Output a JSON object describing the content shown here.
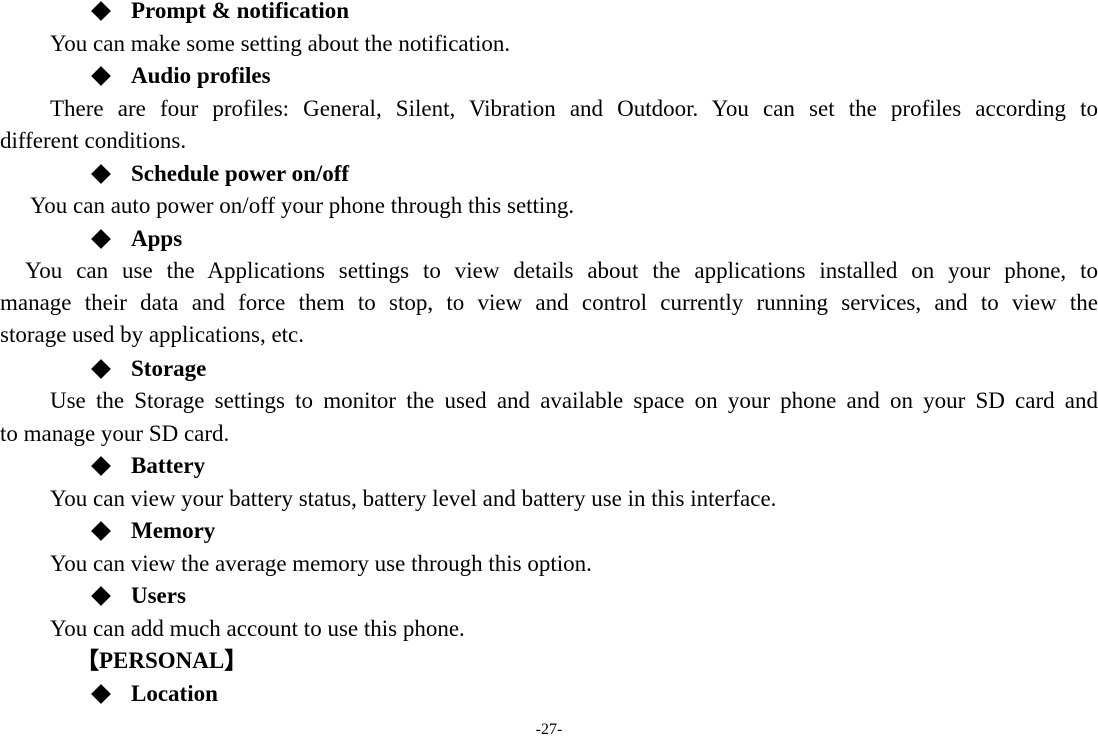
{
  "sections": [
    {
      "title": "Prompt & notification",
      "body_lines": [
        "You can make some setting about the notification."
      ]
    },
    {
      "title": "Audio profiles",
      "body_lines": [
        "There are four profiles: General, Silent, Vibration and Outdoor. You can set the profiles according to",
        "different conditions."
      ]
    },
    {
      "title": "Schedule power on/off",
      "body_lines": [
        "You can auto power on/off your phone through this setting."
      ]
    },
    {
      "title": "Apps",
      "body_lines": [
        "You can use the Applications settings to view details about the applications installed on your phone, to",
        "manage their data and force them to stop, to view and control currently running services, and to view the",
        "storage used by applications, etc."
      ]
    },
    {
      "title": "Storage",
      "body_lines": [
        "Use the Storage settings to monitor the used and available space on your phone and on your SD card and",
        "to manage your SD card."
      ]
    },
    {
      "title": "Battery",
      "body_lines": [
        "You can view your battery status, battery level and battery use in this interface."
      ]
    },
    {
      "title": "Memory",
      "body_lines": [
        "You can view the average memory use through this option."
      ]
    },
    {
      "title": "Users",
      "body_lines": [
        "You can add much account to use this phone."
      ]
    }
  ],
  "category_heading": "【PERSONAL】",
  "next_section_title": "Location",
  "page_number": "-27-"
}
